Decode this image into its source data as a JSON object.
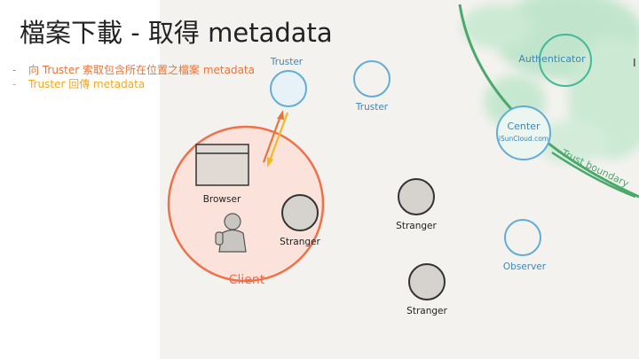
{
  "slide": {
    "title": "檔案下載 - 取得 metadata",
    "bullets": [
      {
        "text": "向 Truster 索取包含所在位置之檔案 metadata",
        "color": "#e8743b"
      },
      {
        "text": "Truster 回傳 metadata",
        "color": "#f2a81d"
      }
    ]
  },
  "diagram": {
    "trusted_zone": {
      "nodes": [
        {
          "id": "authenticator",
          "label": "Authenticator"
        },
        {
          "id": "center",
          "label": "Center",
          "sublabel": "iSunCloud.com"
        }
      ],
      "boundary_label": "Trust boundary"
    },
    "trusters": [
      {
        "id": "truster-top",
        "label": "Truster"
      },
      {
        "id": "truster-right",
        "label": "Truster"
      }
    ],
    "client": {
      "label": "Client",
      "browser_label": "Browser",
      "stranger_label": "Stranger"
    },
    "strangers": [
      {
        "id": "stranger-1",
        "label": "Stranger"
      },
      {
        "id": "stranger-2",
        "label": "Stranger"
      }
    ],
    "observer": {
      "label": "Observer"
    },
    "colors": {
      "node_blue": "#63acd6",
      "node_blue_text": "#3b86b8",
      "node_teal": "#46b89a",
      "trust_green": "#4aa86a",
      "client_red": "#f07048",
      "client_fill": "#fbe3dc",
      "stranger_fill": "#d6d3cf",
      "request_arrow": "#e8743b",
      "response_arrow": "#f5b81d",
      "canvas_bg": "#f4f2ef"
    }
  }
}
